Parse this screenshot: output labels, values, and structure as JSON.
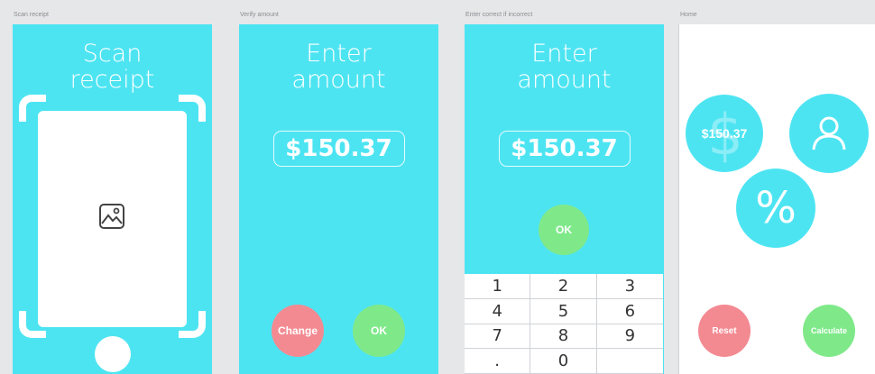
{
  "captions": {
    "scan": "Scan receipt",
    "verify": "Verify amount",
    "enter": "Enter correct if incorrect",
    "home": "Home"
  },
  "scan_screen": {
    "title_line1": "Scan",
    "title_line2": "receipt"
  },
  "verify_screen": {
    "title_line1": "Enter",
    "title_line2": "amount",
    "amount": "$150.37",
    "change_label": "Change",
    "ok_label": "OK"
  },
  "enter_screen": {
    "title_line1": "Enter",
    "title_line2": "amount",
    "amount": "$150.37",
    "ok_label": "OK",
    "keys": [
      "1",
      "2",
      "3",
      "4",
      "5",
      "6",
      "7",
      "8",
      "9",
      ".",
      "0",
      ""
    ]
  },
  "home_screen": {
    "amount_label": "$150.37",
    "percent_symbol": "%",
    "reset_label": "Reset",
    "calculate_label": "Calculate"
  },
  "colors": {
    "cyan": "#4de4f2",
    "red": "#f38a92",
    "green": "#7fe98a",
    "background": "#e6e7e9"
  },
  "icons": [
    "image-icon",
    "dollar-icon",
    "person-icon"
  ]
}
